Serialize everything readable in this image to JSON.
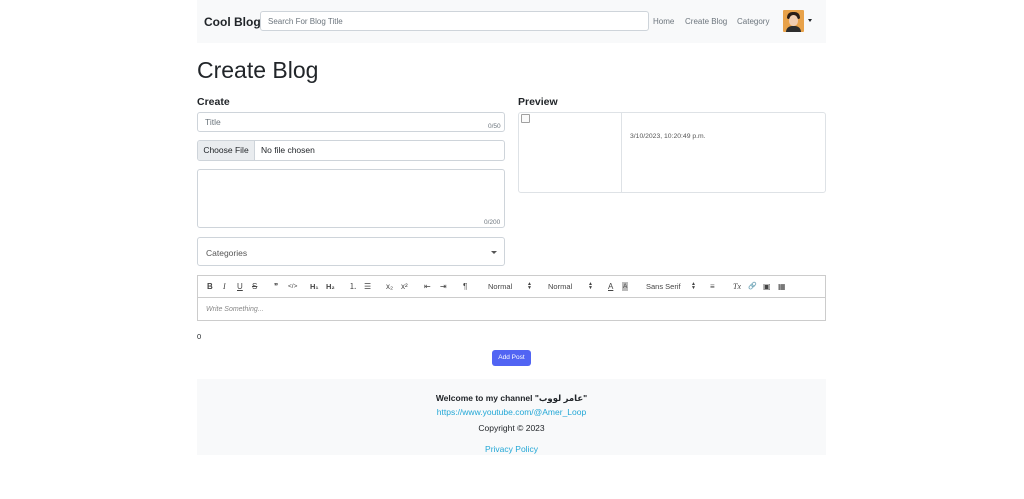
{
  "navbar": {
    "brand": "Cool Blog",
    "search_placeholder": "Search For Blog Title",
    "links": {
      "home": "Home",
      "create_blog": "Create Blog",
      "category": "Category"
    }
  },
  "page": {
    "title": "Create Blog"
  },
  "create": {
    "heading": "Create",
    "title_placeholder": "Title",
    "title_counter": "0/50",
    "file_button": "Choose File",
    "file_status": "No file chosen",
    "description_counter": "0/200",
    "categories_placeholder": "Categories"
  },
  "preview": {
    "heading": "Preview",
    "date": "3/10/2023, 10:20:49 p.m."
  },
  "editor": {
    "toolbar": {
      "bold": "B",
      "italic": "I",
      "underline": "U",
      "strike": "S",
      "blockquote": "❞",
      "code": "</>",
      "h1": "H₁",
      "h2": "H₂",
      "ordered_list": "⒈",
      "bullet_list": "☰",
      "subscript": "x₂",
      "superscript": "x²",
      "outdent": "⇤",
      "indent": "⇥",
      "direction": "¶",
      "size_select": "Normal",
      "header_select": "Normal",
      "font_select": "Sans Serif",
      "color": "A",
      "background": "A",
      "align": "≡",
      "clean": "Tx",
      "link": "🔗",
      "image": "▣",
      "video": "▦"
    },
    "placeholder": "Write Something..."
  },
  "char_count": "0",
  "add_post_button": "Add Post",
  "footer": {
    "welcome": "Welcome to my channel \"عامر لووب\"",
    "youtube_link": "https://www.youtube.com/@Amer_Loop",
    "copyright": "Copyright © 2023",
    "privacy": "Privacy Policy"
  },
  "colors": {
    "accent": "#5164f3",
    "link": "#22a7d6",
    "navbar_bg": "#f8f9fa"
  },
  "icons": [
    "dropdown-caret-icon",
    "select-arrow-icon",
    "broken-image-icon"
  ]
}
